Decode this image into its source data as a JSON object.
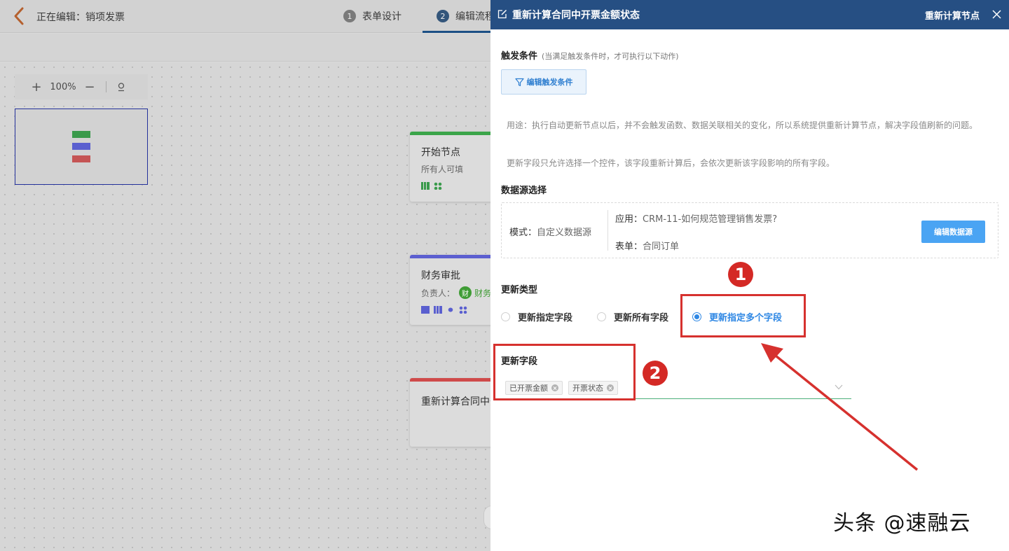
{
  "editor": {
    "editing_label": "正在编辑：销项发票",
    "steps": [
      {
        "num": "1",
        "label": "表单设计"
      },
      {
        "num": "2",
        "label": "编辑流程"
      }
    ],
    "zoom_level": "100%",
    "nodes": [
      {
        "title": "开始节点",
        "sub": "所有人可填",
        "color": "#3ba54a"
      },
      {
        "title": "财务审批",
        "sub_prefix": "负责人：",
        "avatar_char": "财",
        "assignee": "财务",
        "color": "#5c5fd0"
      },
      {
        "title": "重新计算合同中开",
        "color": "#cf4a4a"
      }
    ]
  },
  "drawer": {
    "title": "重新计算合同中开票金额状态",
    "node_type": "重新计算节点",
    "trigger": {
      "label": "触发条件",
      "hint": "(当满足触发条件时，才可执行以下动作)",
      "button": "编辑触发条件"
    },
    "description": [
      "用途：执行自动更新节点以后，并不会触发函数、数据关联相关的变化，所以系统提供重新计算节点，解决字段值刷新的问题。",
      "更新字段只允许选择一个控件，该字段重新计算后，会依次更新该字段影响的所有字段。"
    ],
    "datasource": {
      "label": "数据源选择",
      "mode_key": "模式：",
      "mode_value": "自定义数据源",
      "app_key": "应用：",
      "app_value": "CRM-11-如何规范管理销售发票?",
      "form_key": "表单：",
      "form_value": "合同订单",
      "button": "编辑数据源"
    },
    "update_type": {
      "label": "更新类型",
      "options": [
        "更新指定字段",
        "更新所有字段",
        "更新指定多个字段"
      ],
      "selected": "更新指定多个字段"
    },
    "update_fields": {
      "label": "更新字段",
      "tags": [
        "已开票金额",
        "开票状态"
      ]
    }
  },
  "annotations": {
    "marker_1": "1",
    "marker_2": "2",
    "color": "#d6312e"
  },
  "watermark": "头条 @速融云"
}
